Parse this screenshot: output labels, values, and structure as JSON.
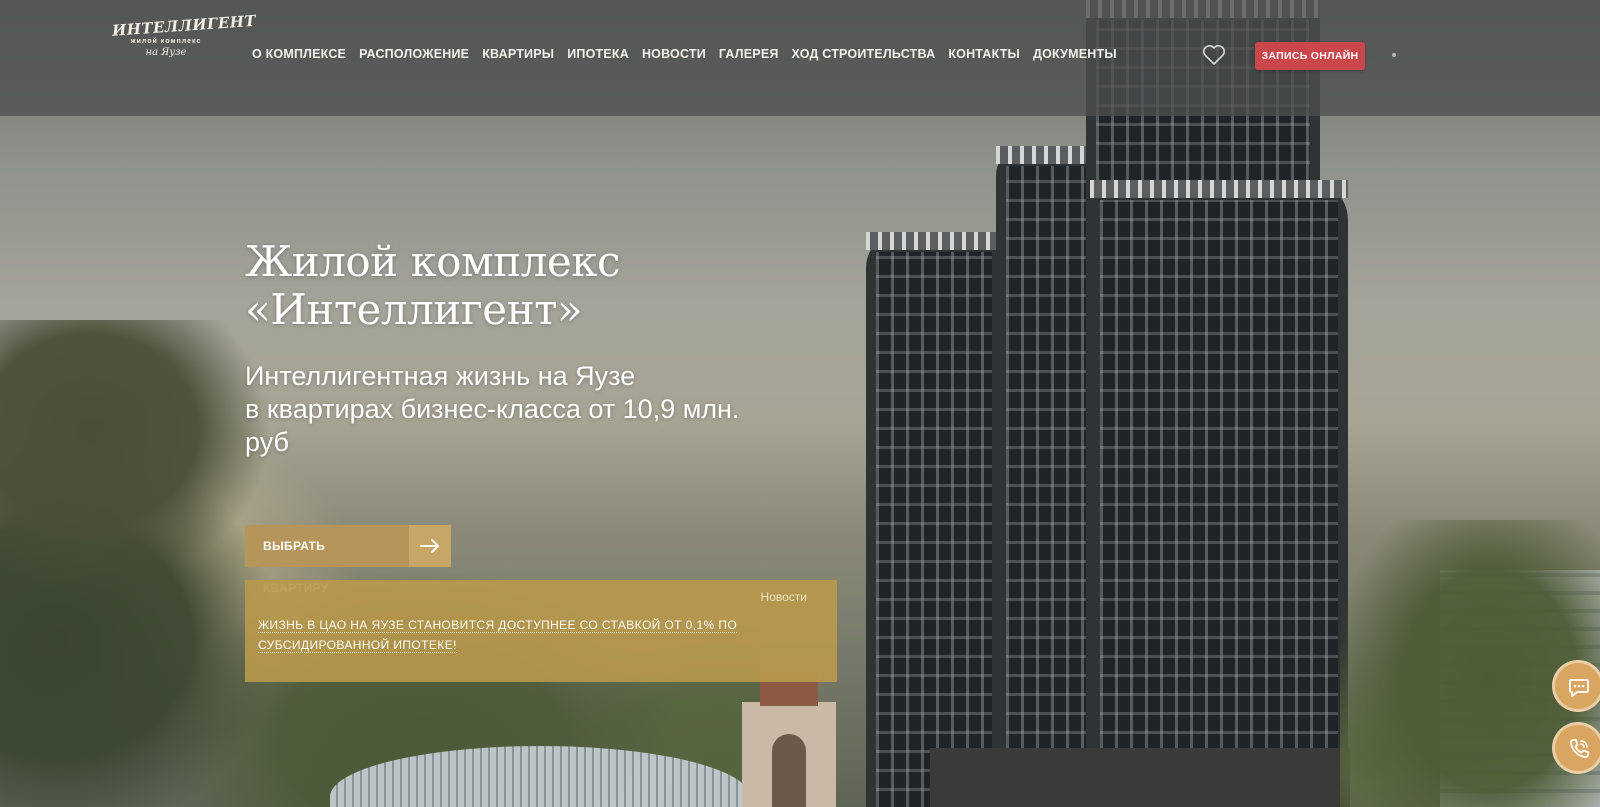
{
  "header": {
    "logo": {
      "main": "ИНТЕЛЛИГЕНТ",
      "sub": "жилой комплекс",
      "sign": "на Яузе"
    },
    "nav": [
      {
        "label": "О КОМПЛЕКСЕ"
      },
      {
        "label": "РАСПОЛОЖЕНИЕ"
      },
      {
        "label": "КВАРТИРЫ"
      },
      {
        "label": "ИПОТЕКА"
      },
      {
        "label": "НОВОСТИ"
      },
      {
        "label": "ГАЛЕРЕЯ"
      },
      {
        "label": "ХОД СТРОИТЕЛЬСТВА"
      },
      {
        "label": "КОНТАКТЫ"
      },
      {
        "label": "ДОКУМЕНТЫ"
      }
    ],
    "favorite_icon": "heart-icon",
    "book_label": "ЗАПИСЬ ОНЛАЙН"
  },
  "hero": {
    "title_line1": "Жилой комплекс",
    "title_line2": "«Интеллигент»",
    "subtitle_line1": "Интеллигентная жизнь на Яузе",
    "subtitle_line2": "в квартирах бизнес-класса от 10,9 млн.",
    "subtitle_line3": "руб",
    "cta_label": "ВЫБРАТЬ КВАРТИРУ",
    "cta_icon": "arrow-right-icon"
  },
  "news": {
    "label": "Новости",
    "line1": "ЖИЗНЬ В ЦАО НА ЯУЗЕ СТАНОВИТСЯ ДОСТУПНЕЕ СО СТАВКОЙ ОТ 0,1% ПО",
    "line2": "СУБСИДИРОВАННОЙ ИПОТЕКЕ!"
  },
  "floating": {
    "chat_icon": "chat-bubble-icon",
    "phone_icon": "phone-icon"
  },
  "colors": {
    "accent_gold": "#b5955a",
    "book_red": "#c9464a",
    "float_orange": "#d9a662"
  }
}
